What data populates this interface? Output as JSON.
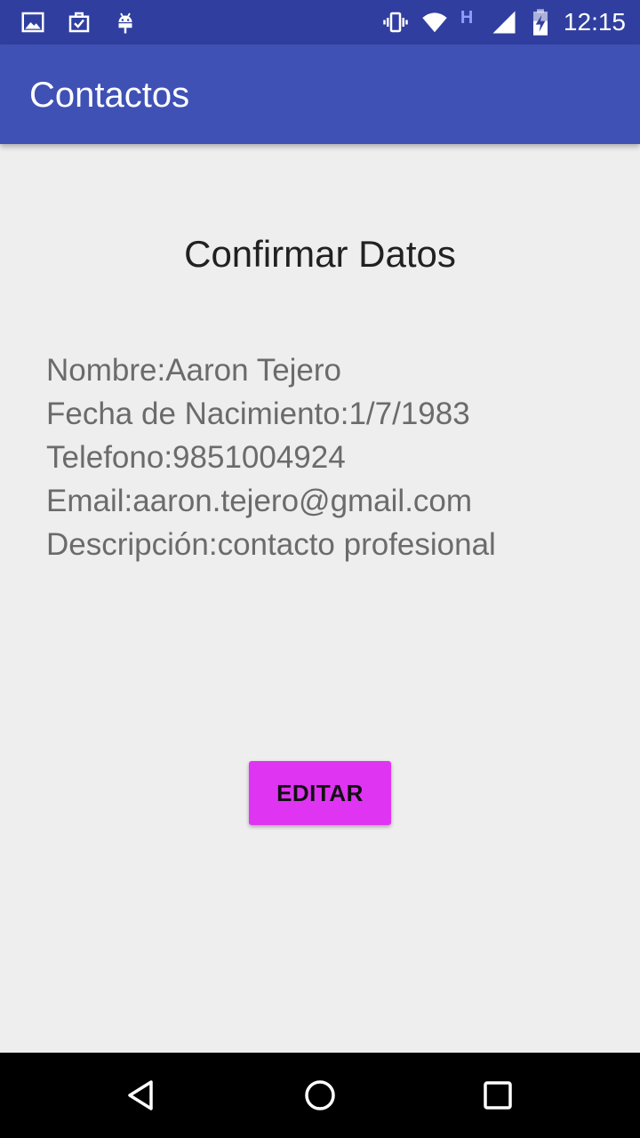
{
  "status_bar": {
    "time": "12:15",
    "network_type": "H",
    "icons": [
      "image-notification-icon",
      "task-notification-icon",
      "android-debug-icon",
      "vibrate-icon",
      "wifi-icon",
      "signal-icon",
      "battery-charging-icon"
    ]
  },
  "app_bar": {
    "title": "Contactos"
  },
  "main": {
    "heading": "Confirmar Datos",
    "details": {
      "nombre": "Nombre:Aaron Tejero",
      "fecha": "Fecha de Nacimiento:1/7/1983",
      "telefono": "Telefono:9851004924",
      "email": "Email:aaron.tejero@gmail.com",
      "descripcion": "Descripción:contacto profesional"
    },
    "edit_button": "EDITAR"
  },
  "nav_bar": {
    "buttons": [
      "back-icon",
      "home-icon",
      "recents-icon"
    ]
  },
  "colors": {
    "status_bar": "#303f9f",
    "app_bar": "#3f51b5",
    "background": "#eeeeee",
    "button": "#df34f2",
    "nav_bar": "#000000"
  }
}
